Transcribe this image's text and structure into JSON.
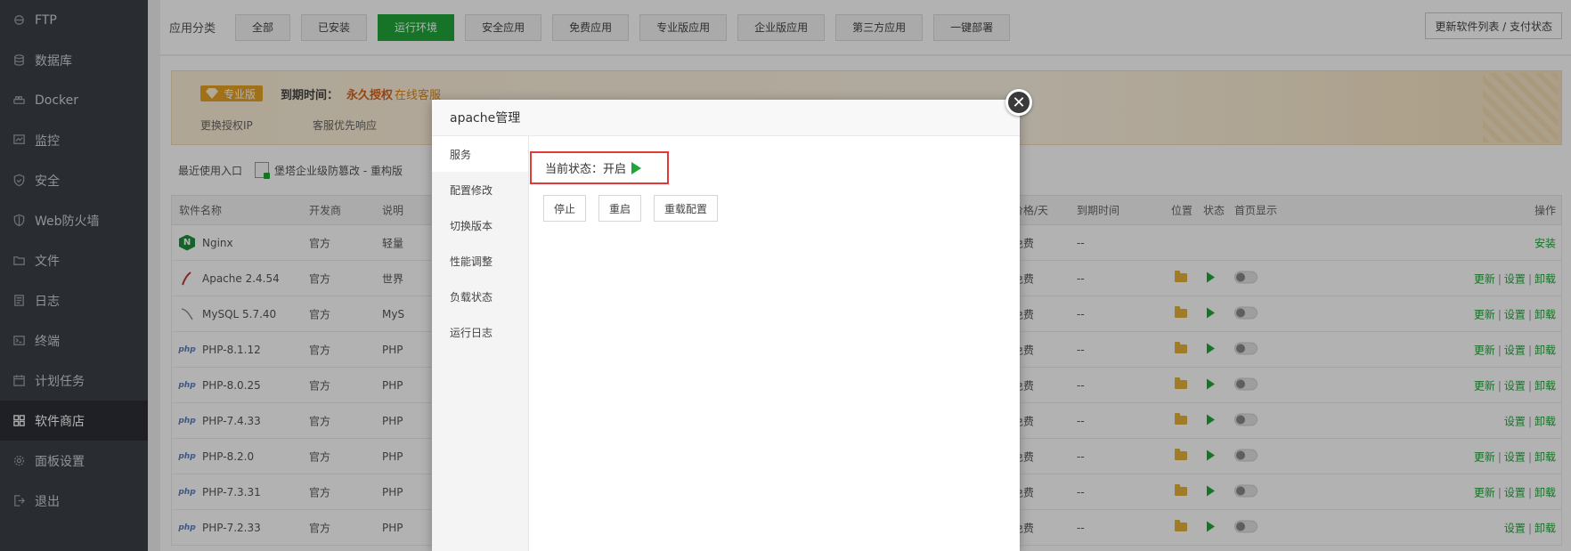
{
  "sidebar": {
    "items": [
      {
        "label": "FTP",
        "icon": "ftp-icon"
      },
      {
        "label": "数据库",
        "icon": "database-icon"
      },
      {
        "label": "Docker",
        "icon": "docker-icon"
      },
      {
        "label": "监控",
        "icon": "monitor-icon"
      },
      {
        "label": "安全",
        "icon": "shield-icon"
      },
      {
        "label": "Web防火墙",
        "icon": "firewall-icon"
      },
      {
        "label": "文件",
        "icon": "folder-icon"
      },
      {
        "label": "日志",
        "icon": "log-icon"
      },
      {
        "label": "终端",
        "icon": "terminal-icon"
      },
      {
        "label": "计划任务",
        "icon": "calendar-icon"
      },
      {
        "label": "软件商店",
        "icon": "grid-icon",
        "active": true
      },
      {
        "label": "面板设置",
        "icon": "gear-icon"
      },
      {
        "label": "退出",
        "icon": "logout-icon"
      }
    ]
  },
  "categories": {
    "label": "应用分类",
    "items": [
      "全部",
      "已安装",
      "运行环境",
      "安全应用",
      "免费应用",
      "专业版应用",
      "企业版应用",
      "第三方应用",
      "一键部署"
    ],
    "active": "运行环境",
    "update_button": "更新软件列表 / 支付状态"
  },
  "banner": {
    "badge": "专业版",
    "expire_label": "到期时间：",
    "expire_value": "永久授权",
    "service": "在线客服",
    "link1": "更换授权IP",
    "link2": "客服优先响应"
  },
  "recent": {
    "label": "最近使用入口",
    "item": "堡塔企业级防篡改 - 重构版"
  },
  "table": {
    "headers": {
      "name": "软件名称",
      "developer": "开发商",
      "desc": "说明",
      "price": "价格/天",
      "expire": "到期时间",
      "position": "位置",
      "state": "状态",
      "home": "首页显示",
      "ops": "操作"
    },
    "rows": [
      {
        "name": "Nginx",
        "icon": "nginx",
        "developer": "官方",
        "desc": "轻量",
        "price": "免费",
        "expire": "--",
        "installed": false,
        "ops": [
          "安装"
        ]
      },
      {
        "name": "Apache 2.4.54",
        "icon": "apache",
        "developer": "官方",
        "desc": "世界",
        "price": "免费",
        "expire": "--",
        "installed": true,
        "ops": [
          "更新",
          "设置",
          "卸载"
        ]
      },
      {
        "name": "MySQL 5.7.40",
        "icon": "mysql",
        "developer": "官方",
        "desc": "MyS",
        "price": "免费",
        "expire": "--",
        "installed": true,
        "ops": [
          "更新",
          "设置",
          "卸载"
        ]
      },
      {
        "name": "PHP-8.1.12",
        "icon": "php",
        "developer": "官方",
        "desc": "PHP",
        "price": "免费",
        "expire": "--",
        "installed": true,
        "ops": [
          "更新",
          "设置",
          "卸载"
        ]
      },
      {
        "name": "PHP-8.0.25",
        "icon": "php",
        "developer": "官方",
        "desc": "PHP",
        "price": "免费",
        "expire": "--",
        "installed": true,
        "ops": [
          "更新",
          "设置",
          "卸载"
        ]
      },
      {
        "name": "PHP-7.4.33",
        "icon": "php",
        "developer": "官方",
        "desc": "PHP",
        "price": "免费",
        "expire": "--",
        "installed": true,
        "ops": [
          "设置",
          "卸载"
        ]
      },
      {
        "name": "PHP-8.2.0",
        "icon": "php",
        "developer": "官方",
        "desc": "PHP",
        "price": "免费",
        "expire": "--",
        "installed": true,
        "ops": [
          "更新",
          "设置",
          "卸载"
        ]
      },
      {
        "name": "PHP-7.3.31",
        "icon": "php",
        "developer": "官方",
        "desc": "PHP",
        "price": "免费",
        "expire": "--",
        "installed": true,
        "ops": [
          "更新",
          "设置",
          "卸载"
        ]
      },
      {
        "name": "PHP-7.2.33",
        "icon": "php",
        "developer": "官方",
        "desc": "PHP",
        "price": "免费",
        "expire": "--",
        "installed": true,
        "ops": [
          "设置",
          "卸载"
        ]
      }
    ]
  },
  "modal": {
    "title": "apache管理",
    "close": "✕",
    "nav": [
      "服务",
      "配置修改",
      "切换版本",
      "性能调整",
      "负载状态",
      "运行日志"
    ],
    "active_nav": "服务",
    "status_label": "当前状态：",
    "status_value": "开启",
    "buttons": [
      "停止",
      "重启",
      "重载配置"
    ]
  },
  "colors": {
    "accent": "#20a53a",
    "highlight": "#e23a3a",
    "sidebar_bg": "#3b3f47"
  }
}
